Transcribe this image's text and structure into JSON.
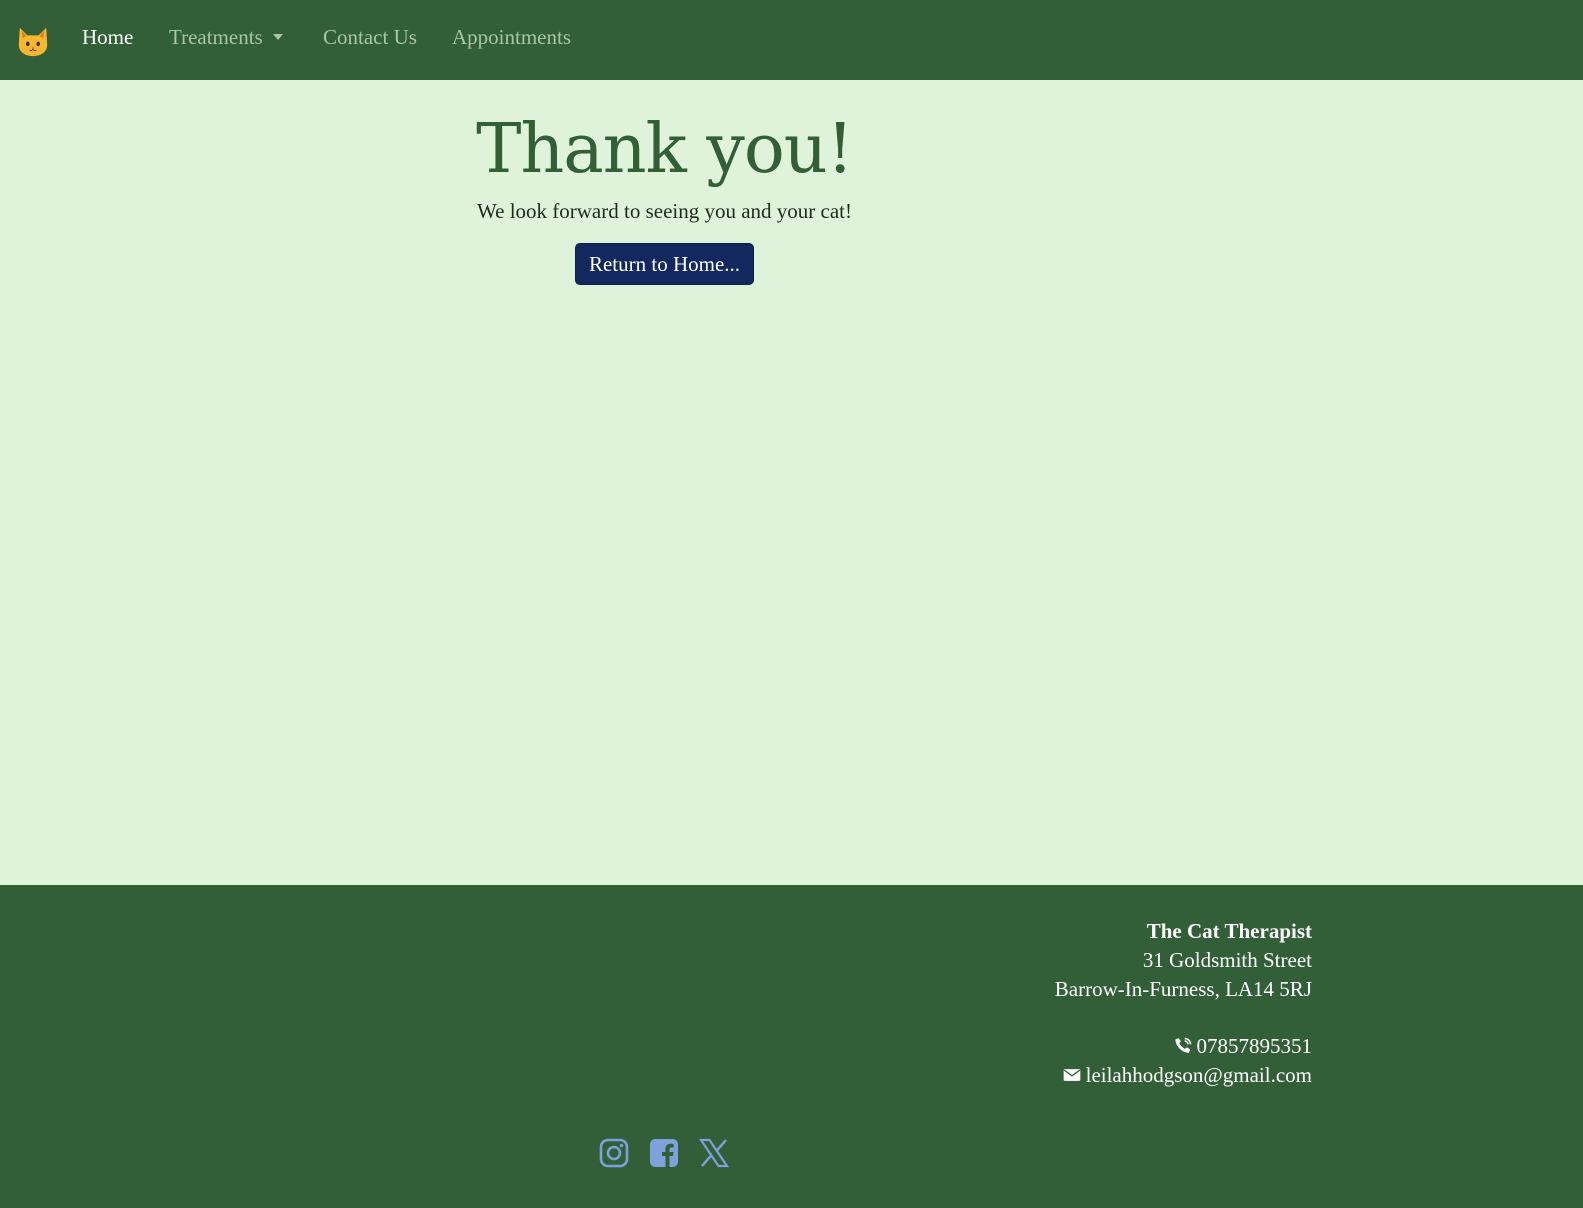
{
  "nav": {
    "brand_icon": "cat-face-icon",
    "links": [
      {
        "label": "Home",
        "active": true
      },
      {
        "label": "Treatments",
        "dropdown": true
      },
      {
        "label": "Contact Us"
      },
      {
        "label": "Appointments"
      }
    ]
  },
  "main": {
    "title": "Thank you!",
    "subtitle": "We look forward to seeing you and your cat!",
    "button_label": "Return to Home..."
  },
  "footer": {
    "business_name": "The Cat Therapist",
    "address_line1": "31 Goldsmith Street",
    "address_line2": "Barrow-In-Furness, LA14 5RJ",
    "phone": "07857895351",
    "email": "leilahhodgson@gmail.com",
    "socials": [
      "instagram-icon",
      "facebook-icon",
      "x-twitter-icon"
    ]
  },
  "colors": {
    "nav_bg": "#325f38",
    "page_bg": "#def3d9",
    "title": "#325f38",
    "button_bg": "#13285e",
    "social_icon": "#7fa0d8"
  }
}
